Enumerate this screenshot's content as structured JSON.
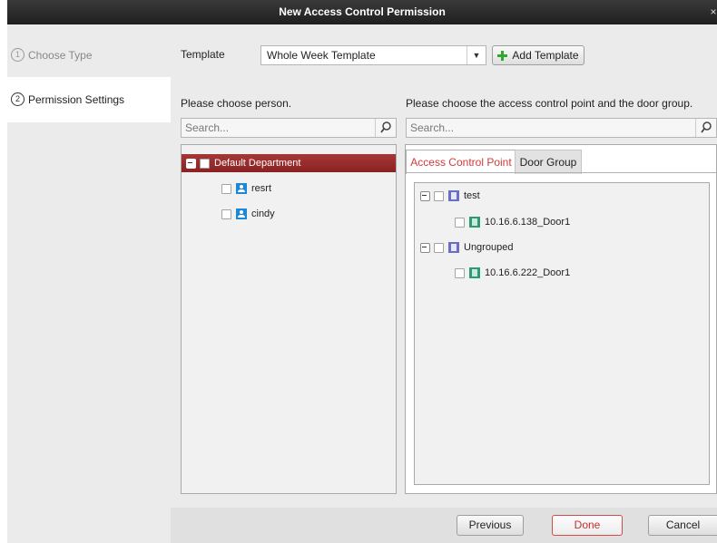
{
  "dialog": {
    "title": "New Access Control Permission",
    "close_glyph": "×"
  },
  "steps": [
    {
      "num": "1",
      "label": "Choose Type"
    },
    {
      "num": "2",
      "label": "Permission Settings"
    }
  ],
  "template": {
    "label": "Template",
    "value": "Whole Week Template",
    "add_label": "Add Template"
  },
  "left_panel": {
    "prompt": "Please choose person.",
    "search_placeholder": "Search...",
    "tree": {
      "department": "Default Department",
      "persons": [
        "resrt",
        "cindy"
      ]
    }
  },
  "right_panel": {
    "prompt": "Please choose the access control point and the door group.",
    "search_placeholder": "Search...",
    "tabs": [
      "Access Control Point",
      "Door Group"
    ],
    "tree": [
      {
        "group": "test",
        "doors": [
          "10.16.6.138_Door1"
        ]
      },
      {
        "group": "Ungrouped",
        "doors": [
          "10.16.6.222_Door1"
        ]
      }
    ]
  },
  "footer": {
    "previous": "Previous",
    "done": "Done",
    "cancel": "Cancel"
  },
  "colors": {
    "accent_red": "#a63737",
    "title_bar": "#2b2b2b",
    "person_icon": "#1d88d6",
    "group_icon": "#6b6fc3",
    "door_icon": "#2d9a73",
    "add_icon": "#2fa82f"
  }
}
